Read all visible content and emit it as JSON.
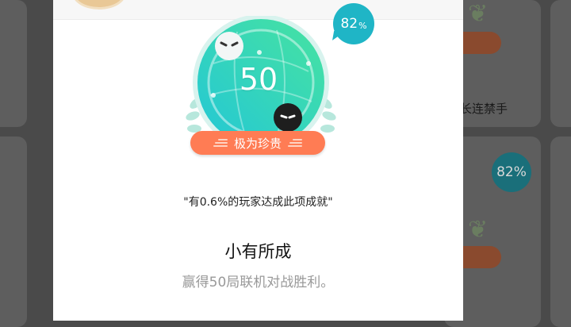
{
  "background": {
    "right_text_1": "长连禁手",
    "bubble_text": "82%"
  },
  "modal": {
    "badge": {
      "number": "50",
      "percent": "82",
      "percent_unit": "%",
      "rarity_label": "极为珍贵"
    },
    "stat_text": "\"有0.6%的玩家达成此项成就\"",
    "title": "小有所成",
    "description": "赢得50局联机对战胜利。"
  },
  "colors": {
    "accent_orange": "#ff7c54",
    "accent_teal": "#1fb5c6",
    "badge_green": "#3fd6a0"
  }
}
